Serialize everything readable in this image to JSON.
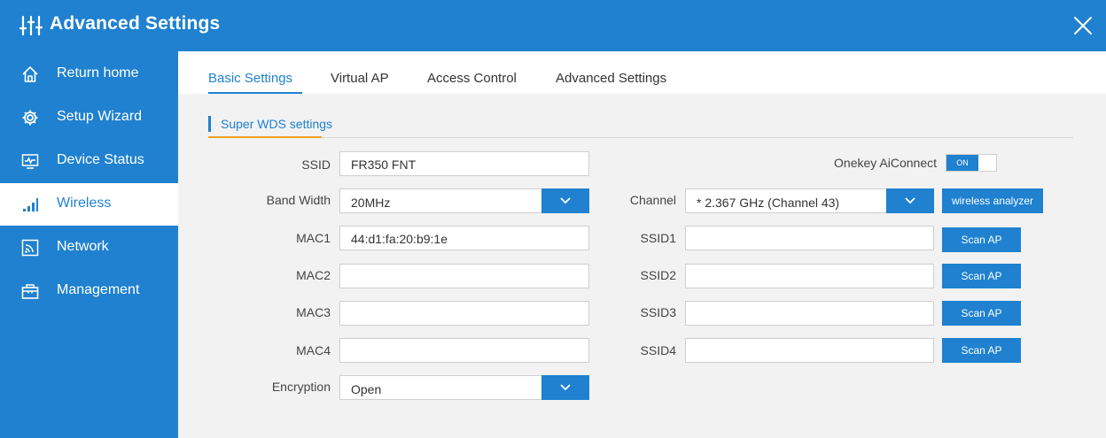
{
  "window": {
    "title": "Advanced Settings"
  },
  "sidebar": {
    "items": [
      {
        "label": "Return home",
        "icon": "home-icon"
      },
      {
        "label": "Setup Wizard",
        "icon": "gear-icon"
      },
      {
        "label": "Device Status",
        "icon": "monitor-icon"
      },
      {
        "label": "Wireless",
        "icon": "signal-icon",
        "active": true
      },
      {
        "label": "Network",
        "icon": "network-icon"
      },
      {
        "label": "Management",
        "icon": "toolbox-icon"
      }
    ]
  },
  "tabs": [
    "Basic Settings",
    "Virtual AP",
    "Access Control",
    "Advanced Settings"
  ],
  "section": {
    "title": "Super WDS settings"
  },
  "form": {
    "ssid": {
      "label": "SSID",
      "value": "FR350 FNT"
    },
    "bandwidth": {
      "label": "Band Width",
      "value": "20MHz"
    },
    "mac1": {
      "label": "MAC1",
      "value": "44:d1:fa:20:b9:1e"
    },
    "mac2": {
      "label": "MAC2",
      "value": ""
    },
    "mac3": {
      "label": "MAC3",
      "value": ""
    },
    "mac4": {
      "label": "MAC4",
      "value": ""
    },
    "encryption": {
      "label": "Encryption",
      "value": "Open"
    },
    "aiconnect": {
      "label": "Onekey AiConnect",
      "state": "ON"
    },
    "channel": {
      "label": "Channel",
      "value": "* 2.367 GHz (Channel 43)"
    },
    "wireless_analyzer": "wireless analyzer",
    "ssid1": {
      "label": "SSID1",
      "value": ""
    },
    "ssid2": {
      "label": "SSID2",
      "value": ""
    },
    "ssid3": {
      "label": "SSID3",
      "value": ""
    },
    "ssid4": {
      "label": "SSID4",
      "value": ""
    },
    "scan_label": "Scan AP"
  },
  "colors": {
    "primary": "#1f81cf",
    "accent": "#f0a020",
    "background": "#f2f2f2"
  }
}
